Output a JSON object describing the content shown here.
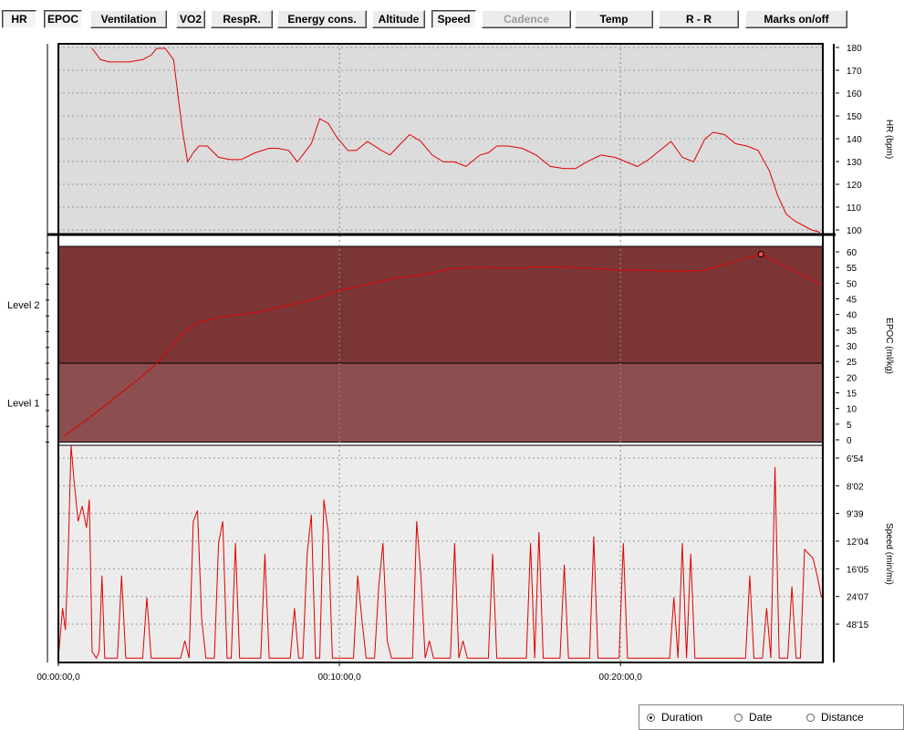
{
  "toolbar": {
    "buttons": [
      {
        "label": "HR",
        "state": "pressed"
      },
      {
        "label": "EPOC",
        "state": "pressed"
      },
      {
        "label": "Ventilation",
        "state": "normal"
      },
      {
        "label": "VO2",
        "state": "normal"
      },
      {
        "label": "RespR.",
        "state": "normal"
      },
      {
        "label": "Energy cons.",
        "state": "normal"
      },
      {
        "label": "Altitude",
        "state": "normal"
      },
      {
        "label": "Speed",
        "state": "pressed"
      },
      {
        "label": "Cadence",
        "state": "disabled"
      },
      {
        "label": "Temp",
        "state": "normal"
      },
      {
        "label": "R - R",
        "state": "normal"
      },
      {
        "label": "Marks on/off",
        "state": "normal"
      }
    ]
  },
  "x_axis": {
    "tick_labels": [
      "00:00:00,0",
      "00:10:00,0",
      "00:20:00,0"
    ],
    "ticks_minutes": [
      0,
      10,
      20
    ],
    "range_minutes": [
      0,
      27.2
    ]
  },
  "epoc_levels": [
    {
      "label": "Level 2",
      "from": 25,
      "to": 62,
      "color": "#7b3535"
    },
    {
      "label": "Level 1",
      "from": 0,
      "to": 25,
      "color": "#8c4e4e"
    }
  ],
  "chart_data": [
    {
      "type": "line",
      "ylabel": "HR (bpm)",
      "yticks": [
        "180",
        "170",
        "160",
        "150",
        "140",
        "130",
        "120",
        "110",
        "100"
      ],
      "ylim": [
        98,
        182
      ],
      "color": "#e00000",
      "background": "#dcdcdc",
      "grid": true,
      "x": [
        1.2,
        1.5,
        1.8,
        2.0,
        2.5,
        3.0,
        3.3,
        3.5,
        3.8,
        4.1,
        4.25,
        4.4,
        4.6,
        4.8,
        5.0,
        5.3,
        5.7,
        6.1,
        6.5,
        7.0,
        7.5,
        7.8,
        8.2,
        8.5,
        9.0,
        9.3,
        9.6,
        9.9,
        10.3,
        10.6,
        11.0,
        11.5,
        11.8,
        12.1,
        12.5,
        12.9,
        13.3,
        13.7,
        14.1,
        14.5,
        15.0,
        15.3,
        15.6,
        16.0,
        16.5,
        17.0,
        17.5,
        18.0,
        18.4,
        18.8,
        19.3,
        19.8,
        20.2,
        20.6,
        21.0,
        21.4,
        21.8,
        22.2,
        22.6,
        23.0,
        23.3,
        23.7,
        24.1,
        24.5,
        24.9,
        25.3,
        25.6,
        25.9,
        26.2,
        26.5,
        26.8,
        27.1
      ],
      "y": [
        180,
        175,
        174,
        174,
        174,
        175,
        177,
        180,
        180,
        175,
        160,
        145,
        130,
        134,
        137,
        137,
        132,
        131,
        131,
        134,
        136,
        136,
        135,
        130,
        138,
        149,
        147,
        141,
        135,
        135,
        139,
        135,
        133,
        137,
        142,
        139,
        133,
        130,
        130,
        128,
        133,
        134,
        137,
        137,
        136,
        133,
        128,
        127,
        127,
        130,
        133,
        132,
        130,
        128,
        131,
        135,
        139,
        132,
        130,
        140,
        143,
        142,
        138,
        137,
        135,
        126,
        115,
        107,
        104,
        102,
        100,
        99
      ]
    },
    {
      "type": "line",
      "ylabel": "EPOC (ml/kg)",
      "yticks": [
        "60",
        "55",
        "50",
        "45",
        "40",
        "35",
        "30",
        "25",
        "20",
        "15",
        "10",
        "5",
        "0"
      ],
      "ylim": [
        -1,
        62
      ],
      "color": "#e00000",
      "marker": {
        "x": 25.0,
        "y": 59.5
      },
      "x": [
        0.2,
        1.0,
        2.0,
        3.0,
        3.5,
        4.0,
        4.5,
        5.0,
        6.0,
        7.0,
        8.0,
        9.0,
        10.0,
        11.0,
        12.0,
        13.0,
        14.0,
        15.0,
        16.0,
        17.0,
        18.0,
        19.0,
        20.0,
        21.0,
        22.0,
        23.0,
        24.0,
        25.0,
        26.0,
        27.1
      ],
      "y": [
        2,
        7,
        14,
        21,
        25,
        30,
        35,
        38,
        40,
        41,
        43,
        45,
        48,
        50,
        52,
        53,
        55,
        55.5,
        55,
        55.5,
        55.5,
        55,
        54.5,
        54.5,
        54,
        54.5,
        57,
        59.5,
        55,
        50
      ]
    },
    {
      "type": "line",
      "ylabel": "Speed (min/mi)",
      "yticks": [
        "6'54",
        "8'02",
        "9'39",
        "12'04",
        "16'05",
        "24'07",
        "48'15"
      ],
      "ylim": [
        0,
        1
      ],
      "color": "#e00000",
      "background": "#ececec",
      "grid": true,
      "x": [
        0,
        0.15,
        0.25,
        0.35,
        0.45,
        0.55,
        0.7,
        0.85,
        1.0,
        1.1,
        1.2,
        1.35,
        1.45,
        1.55,
        1.65,
        1.75,
        1.85,
        1.95,
        2.1,
        2.25,
        2.4,
        2.55,
        2.7,
        2.85,
        3.0,
        3.15,
        3.3,
        3.45,
        3.6,
        3.75,
        3.9,
        4.05,
        4.2,
        4.35,
        4.5,
        4.65,
        4.8,
        4.95,
        5.1,
        5.25,
        5.4,
        5.55,
        5.7,
        5.85,
        6.0,
        6.15,
        6.3,
        6.45,
        6.6,
        6.75,
        6.9,
        7.05,
        7.2,
        7.35,
        7.5,
        7.65,
        7.8,
        7.95,
        8.1,
        8.25,
        8.4,
        8.55,
        8.7,
        8.85,
        9.0,
        9.15,
        9.3,
        9.45,
        9.6,
        9.75,
        9.9,
        10.05,
        10.2,
        10.35,
        10.5,
        10.65,
        10.8,
        10.95,
        11.1,
        11.25,
        11.4,
        11.55,
        11.7,
        11.85,
        12.0,
        12.15,
        12.3,
        12.45,
        12.6,
        12.75,
        12.9,
        13.05,
        13.2,
        13.35,
        13.5,
        13.65,
        13.8,
        13.95,
        14.1,
        14.25,
        14.4,
        14.55,
        14.7,
        14.85,
        15.0,
        15.15,
        15.3,
        15.45,
        15.6,
        15.75,
        15.9,
        16.05,
        16.2,
        16.35,
        16.5,
        16.65,
        16.8,
        16.95,
        17.1,
        17.25,
        17.4,
        17.55,
        17.7,
        17.85,
        18.0,
        18.15,
        18.3,
        18.45,
        18.6,
        18.75,
        18.9,
        19.05,
        19.2,
        19.35,
        19.5,
        19.65,
        19.8,
        19.95,
        20.1,
        20.25,
        20.4,
        20.55,
        20.7,
        20.85,
        21.0,
        21.15,
        21.3,
        21.45,
        21.6,
        21.75,
        21.9,
        22.05,
        22.2,
        22.35,
        22.5,
        22.65,
        22.8,
        22.95,
        23.1,
        23.25,
        23.4,
        23.55,
        23.7,
        23.85,
        24.0,
        24.15,
        24.3,
        24.45,
        24.6,
        24.75,
        24.9,
        25.05,
        25.2,
        25.35,
        25.5,
        25.65,
        25.8,
        25.95,
        26.1,
        26.25,
        26.4,
        26.55,
        26.7,
        26.85,
        27.0,
        27.15
      ],
      "y": [
        0.02,
        0.25,
        0.15,
        0.5,
        1.0,
        0.85,
        0.65,
        0.72,
        0.62,
        0.75,
        0.05,
        0.02,
        0.05,
        0.4,
        0.02,
        0.02,
        0.02,
        0.02,
        0.02,
        0.4,
        0.02,
        0.02,
        0.02,
        0.02,
        0.02,
        0.3,
        0.02,
        0.02,
        0.02,
        0.02,
        0.02,
        0.02,
        0.02,
        0.02,
        0.1,
        0.02,
        0.65,
        0.7,
        0.2,
        0.02,
        0.02,
        0.02,
        0.55,
        0.65,
        0.02,
        0.02,
        0.55,
        0.02,
        0.02,
        0.02,
        0.02,
        0.02,
        0.02,
        0.5,
        0.02,
        0.02,
        0.02,
        0.02,
        0.02,
        0.02,
        0.25,
        0.02,
        0.02,
        0.5,
        0.68,
        0.02,
        0.02,
        0.75,
        0.6,
        0.02,
        0.02,
        0.02,
        0.02,
        0.02,
        0.02,
        0.4,
        0.2,
        0.02,
        0.02,
        0.02,
        0.35,
        0.55,
        0.1,
        0.02,
        0.02,
        0.02,
        0.02,
        0.02,
        0.02,
        0.65,
        0.4,
        0.02,
        0.1,
        0.02,
        0.02,
        0.02,
        0.02,
        0.02,
        0.55,
        0.02,
        0.1,
        0.02,
        0.02,
        0.02,
        0.02,
        0.02,
        0.02,
        0.5,
        0.02,
        0.02,
        0.02,
        0.02,
        0.02,
        0.02,
        0.02,
        0.02,
        0.55,
        0.02,
        0.6,
        0.02,
        0.02,
        0.02,
        0.02,
        0.02,
        0.45,
        0.02,
        0.02,
        0.02,
        0.02,
        0.02,
        0.02,
        0.58,
        0.02,
        0.02,
        0.02,
        0.02,
        0.02,
        0.02,
        0.55,
        0.02,
        0.02,
        0.02,
        0.02,
        0.02,
        0.02,
        0.02,
        0.02,
        0.02,
        0.02,
        0.02,
        0.3,
        0.02,
        0.55,
        0.02,
        0.5,
        0.02,
        0.02,
        0.02,
        0.02,
        0.02,
        0.02,
        0.02,
        0.02,
        0.02,
        0.02,
        0.02,
        0.02,
        0.02,
        0.4,
        0.02,
        0.02,
        0.02,
        0.25,
        0.02,
        0.9,
        0.02,
        0.02,
        0.02,
        0.35,
        0.02,
        0.02,
        0.52,
        0.5,
        0.48,
        0.4,
        0.3,
        0.2,
        0.35,
        0.42
      ]
    }
  ],
  "view_options": {
    "options": [
      {
        "label": "Duration",
        "selected": true
      },
      {
        "label": "Date",
        "selected": false
      },
      {
        "label": "Distance",
        "selected": false
      }
    ]
  }
}
